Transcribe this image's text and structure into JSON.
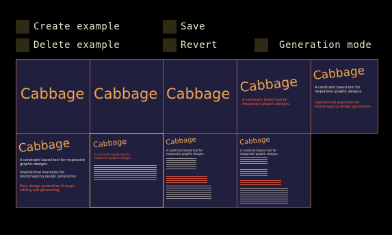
{
  "toolbar": {
    "create_example": "Create example",
    "delete_example": "Delete example",
    "save": "Save",
    "revert": "Revert",
    "generation_mode": "Generation mode"
  },
  "examples": [
    {
      "title": "Cabbage"
    },
    {
      "title": "Cabbage"
    },
    {
      "title": "Cabbage"
    },
    {
      "title": "Cabbage",
      "tagline": "A constraint based tool for responsive graphic designs."
    },
    {
      "title": "Cabbage",
      "tagline": "A constraint based tool for responsive graphic designs.",
      "sub": "Inspirational examples for bootstrapping design generation."
    },
    {
      "title": "Cabbage",
      "tagline": "A constraint based tool for responsive graphic designs.",
      "sub": "Inspirational examples for bootstrapping design generation.",
      "note": "Easy design generation through editing and generating."
    },
    {
      "title": "Cabbage",
      "tagline": "A constraint based tool for responsive graphic designs."
    },
    {
      "title": "Cabbage",
      "tagline": "A constraint based tool for responsive graphic designs."
    },
    {
      "title": "Cabbage",
      "tagline": "A constraint based tool for responsive graphic designs."
    }
  ],
  "colors": {
    "background": "#000000",
    "toolbar_text": "#ece6cf",
    "toolbar_box": "#2e2a14",
    "cell_bg": "#211f3e",
    "cell_border": "#a25a4e",
    "selected_border": "#d7cd4a",
    "brand": "#f3a74e",
    "accent_red": "#ff5e3a"
  },
  "selected_index": 6
}
